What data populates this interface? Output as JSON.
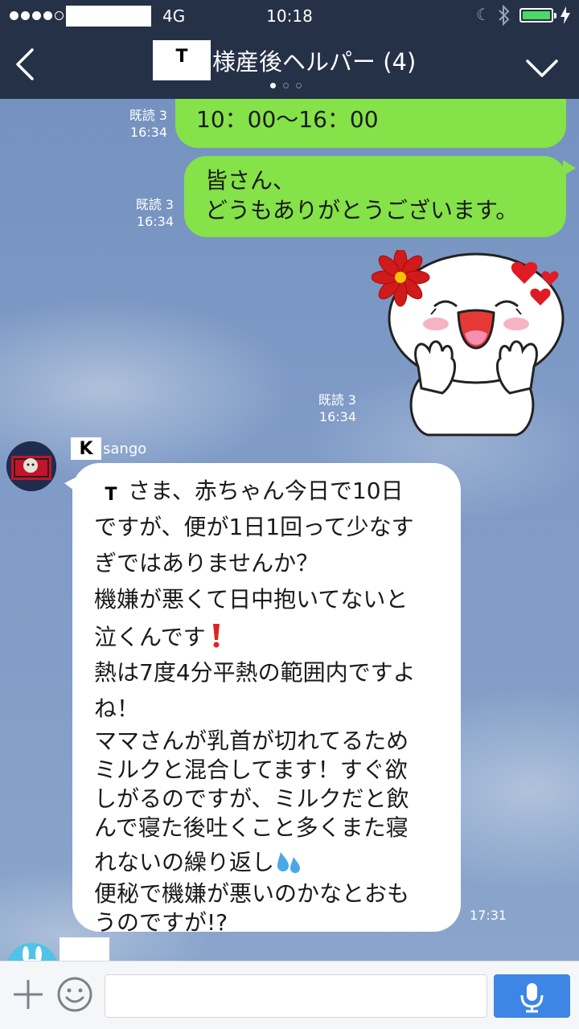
{
  "status": {
    "network": "4G",
    "time": "10:18",
    "battery_level": 1.0,
    "icons": [
      "signal-dots-icon",
      "moon-icon",
      "bluetooth-icon",
      "battery-icon",
      "charging-icon"
    ]
  },
  "header": {
    "title_redacted_initial": "T",
    "title_text": "様産後ヘルパー (4)",
    "page_dots": {
      "count": 3,
      "active": 1
    },
    "icons": [
      "back-chevron-icon",
      "dropdown-chevron-icon"
    ]
  },
  "messages": {
    "m1": {
      "text": "10：00〜16：00",
      "read_label": "既読 3",
      "time": "16:34"
    },
    "m2": {
      "line1": "皆さん、",
      "line2": "どうもありがとうございます。",
      "read_label": "既読 3",
      "time": "16:34"
    },
    "m3": {
      "sticker": "smiling-moon-flower-hearts-sticker",
      "read_label": "既読 3",
      "time": "16:34"
    },
    "m4": {
      "sender_redacted_initial": "K",
      "sender_rest": "sango",
      "redacted_initial": "T",
      "lines": [
        "さま、赤ちゃん今日で10日",
        "ですが、便が1日1回って少なす",
        "ぎではありませんか？",
        "機嫌が悪くて日中抱いてないと",
        "泣くんです",
        "熱は7度4分平熱の範囲内ですよ",
        "ね！",
        "ママさんが乳首が切れてるため",
        "ミルクと混合してます！すぐ欲",
        "しがるのですが、ミルクだと飲",
        "んで寝た後吐くこと多くまた寝",
        "れないの繰り返し",
        "便秘で機嫌が悪いのかなとおも",
        "うのですが!?"
      ],
      "emojis": [
        "exclamation-emoji",
        "sweat-droplets-emoji"
      ],
      "time": "17:31"
    }
  },
  "composer": {
    "input_value": "",
    "icons": [
      "plus-icon",
      "smiley-icon",
      "microphone-icon"
    ]
  },
  "colors": {
    "header_bg": "#253147",
    "outgoing_bubble": "#85e249",
    "incoming_bubble": "#ffffff",
    "mic_button": "#3d86e6"
  }
}
